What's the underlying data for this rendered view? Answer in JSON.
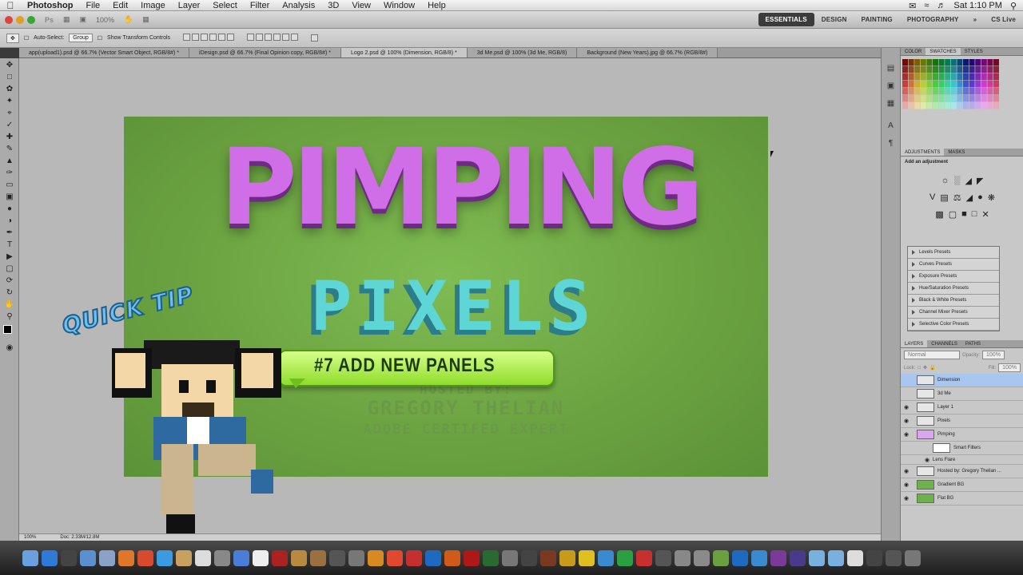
{
  "menubar": {
    "app_name": "Photoshop",
    "items": [
      "File",
      "Edit",
      "Image",
      "Layer",
      "Select",
      "Filter",
      "Analysis",
      "3D",
      "View",
      "Window",
      "Help"
    ],
    "clock": "Sat 1:10 PM"
  },
  "appbar": {
    "zoom": "100%",
    "workspaces": [
      "ESSENTIALS",
      "DESIGN",
      "PAINTING",
      "PHOTOGRAPHY"
    ],
    "cs_live": "CS Live"
  },
  "options": {
    "auto_select": "Auto-Select:",
    "group": "Group",
    "show_transform": "Show Transform Controls"
  },
  "tabs": [
    "app(upload1).psd @ 66.7% (Vector Smart Object, RGB/8#) *",
    "iDesign.psd @ 66.7% (Final Opinion copy, RGB/8#) *",
    "Logo 2.psd @ 100% (Dimension, RGB/8) *",
    "3d Me.psd @ 100% (3d Me, RGB/8)",
    "Background (New Years).jpg @ 66.7% (RGB/8#)"
  ],
  "artwork": {
    "title1": "PIMPING",
    "title2": "PIXELS",
    "hosted1": "HOSTED BY:",
    "hosted2": "GREGORY THELIAN",
    "hosted3": "ADOBE CERTIFED EXPERT",
    "bubble": "#7 ADD NEW PANELS",
    "quicktip": "QUICK TIP"
  },
  "status": {
    "zoom": "100%",
    "doc": "Doc: 2.33M/12.8M"
  },
  "panels": {
    "color_tabs": [
      "COLOR",
      "SWATCHES",
      "STYLES"
    ],
    "adj_tabs": [
      "ADJUSTMENTS",
      "MASKS"
    ],
    "add_adjustment": "Add an adjustment",
    "presets": [
      "Levels Presets",
      "Curves Presets",
      "Exposure Presets",
      "Hue/Saturation Presets",
      "Black & White Presets",
      "Channel Mixer Presets",
      "Selective Color Presets"
    ],
    "layer_tabs": [
      "LAYERS",
      "CHANNELS",
      "PATHS"
    ],
    "blend": "Normal",
    "opacity_label": "Opacity:",
    "opacity": "100%",
    "lock_label": "Lock:",
    "fill_label": "Fill:",
    "fill": "100%",
    "layers": [
      "Dimension",
      "3d Me",
      "Layer 1",
      "Pixels",
      "Pimping",
      "Smart Filters",
      "Lens Flare",
      "Hosted by: Gregory Thelian ...",
      "Gradient BG",
      "Flat BG"
    ]
  }
}
